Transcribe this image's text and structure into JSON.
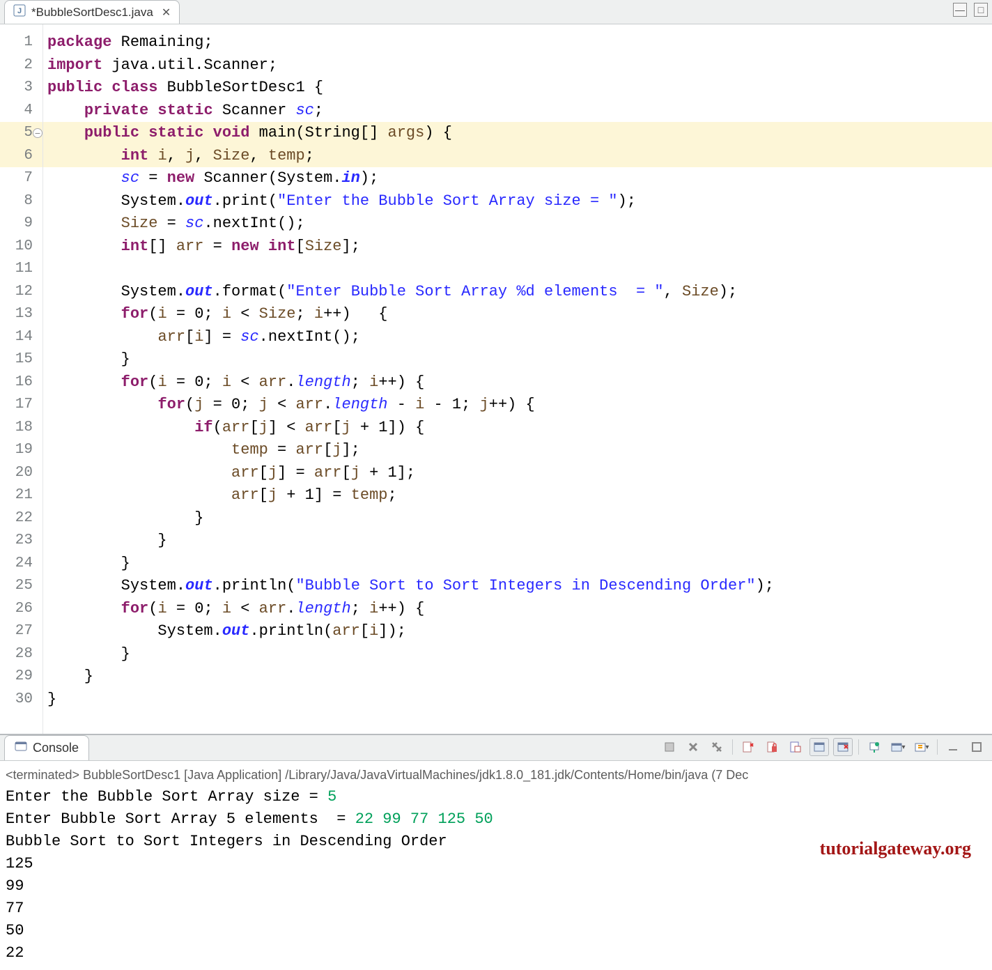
{
  "editor": {
    "tab": {
      "filename": "*BubbleSortDesc1.java"
    },
    "lines": [
      {
        "n": 1,
        "hl": false,
        "tokens": [
          [
            "kw",
            "package"
          ],
          [
            "pln",
            " Remaining;"
          ]
        ]
      },
      {
        "n": 2,
        "hl": false,
        "tokens": [
          [
            "kw",
            "import"
          ],
          [
            "pln",
            " java.util.Scanner;"
          ]
        ]
      },
      {
        "n": 3,
        "hl": false,
        "tokens": [
          [
            "kw",
            "public class"
          ],
          [
            "pln",
            " BubbleSortDesc1 {"
          ]
        ]
      },
      {
        "n": 4,
        "hl": false,
        "tokens": [
          [
            "pln",
            "    "
          ],
          [
            "kw",
            "private static"
          ],
          [
            "pln",
            " Scanner "
          ],
          [
            "sfld",
            "sc"
          ],
          [
            "pln",
            ";"
          ]
        ]
      },
      {
        "n": 5,
        "hl": true,
        "fold": true,
        "tokens": [
          [
            "pln",
            "    "
          ],
          [
            "kw",
            "public static void"
          ],
          [
            "pln",
            " main(String[] "
          ],
          [
            "parm",
            "args"
          ],
          [
            "pln",
            ") {"
          ]
        ]
      },
      {
        "n": 6,
        "hl": true,
        "tokens": [
          [
            "pln",
            "        "
          ],
          [
            "kw",
            "int"
          ],
          [
            "pln",
            " "
          ],
          [
            "var",
            "i"
          ],
          [
            "pln",
            ", "
          ],
          [
            "var",
            "j"
          ],
          [
            "pln",
            ", "
          ],
          [
            "var",
            "Size"
          ],
          [
            "pln",
            ", "
          ],
          [
            "var",
            "temp"
          ],
          [
            "pln",
            ";"
          ]
        ]
      },
      {
        "n": 7,
        "hl": false,
        "tokens": [
          [
            "pln",
            "        "
          ],
          [
            "sfld",
            "sc"
          ],
          [
            "pln",
            " = "
          ],
          [
            "kw",
            "new"
          ],
          [
            "pln",
            " Scanner(System."
          ],
          [
            "fld",
            "in"
          ],
          [
            "pln",
            ");"
          ]
        ]
      },
      {
        "n": 8,
        "hl": false,
        "tokens": [
          [
            "pln",
            "        System."
          ],
          [
            "fld",
            "out"
          ],
          [
            "pln",
            ".print("
          ],
          [
            "str",
            "\"Enter the Bubble Sort Array size = \""
          ],
          [
            "pln",
            ");"
          ]
        ]
      },
      {
        "n": 9,
        "hl": false,
        "tokens": [
          [
            "pln",
            "        "
          ],
          [
            "var",
            "Size"
          ],
          [
            "pln",
            " = "
          ],
          [
            "sfld",
            "sc"
          ],
          [
            "pln",
            ".nextInt();"
          ]
        ]
      },
      {
        "n": 10,
        "hl": false,
        "tokens": [
          [
            "pln",
            "        "
          ],
          [
            "kw",
            "int"
          ],
          [
            "pln",
            "[] "
          ],
          [
            "var",
            "arr"
          ],
          [
            "pln",
            " = "
          ],
          [
            "kw",
            "new int"
          ],
          [
            "pln",
            "["
          ],
          [
            "var",
            "Size"
          ],
          [
            "pln",
            "];"
          ]
        ]
      },
      {
        "n": 11,
        "hl": false,
        "tokens": [
          [
            "pln",
            ""
          ]
        ]
      },
      {
        "n": 12,
        "hl": false,
        "tokens": [
          [
            "pln",
            "        System."
          ],
          [
            "fld",
            "out"
          ],
          [
            "pln",
            ".format("
          ],
          [
            "str",
            "\"Enter Bubble Sort Array %d elements  = \""
          ],
          [
            "pln",
            ", "
          ],
          [
            "var",
            "Size"
          ],
          [
            "pln",
            ");"
          ]
        ]
      },
      {
        "n": 13,
        "hl": false,
        "tokens": [
          [
            "pln",
            "        "
          ],
          [
            "kw",
            "for"
          ],
          [
            "pln",
            "("
          ],
          [
            "var",
            "i"
          ],
          [
            "pln",
            " = 0; "
          ],
          [
            "var",
            "i"
          ],
          [
            "pln",
            " < "
          ],
          [
            "var",
            "Size"
          ],
          [
            "pln",
            "; "
          ],
          [
            "var",
            "i"
          ],
          [
            "pln",
            "++)   {"
          ]
        ]
      },
      {
        "n": 14,
        "hl": false,
        "tokens": [
          [
            "pln",
            "            "
          ],
          [
            "var",
            "arr"
          ],
          [
            "pln",
            "["
          ],
          [
            "var",
            "i"
          ],
          [
            "pln",
            "] = "
          ],
          [
            "sfld",
            "sc"
          ],
          [
            "pln",
            ".nextInt();"
          ]
        ]
      },
      {
        "n": 15,
        "hl": false,
        "tokens": [
          [
            "pln",
            "        }"
          ]
        ]
      },
      {
        "n": 16,
        "hl": false,
        "tokens": [
          [
            "pln",
            "        "
          ],
          [
            "kw",
            "for"
          ],
          [
            "pln",
            "("
          ],
          [
            "var",
            "i"
          ],
          [
            "pln",
            " = 0; "
          ],
          [
            "var",
            "i"
          ],
          [
            "pln",
            " < "
          ],
          [
            "var",
            "arr"
          ],
          [
            "pln",
            "."
          ],
          [
            "sfld",
            "length"
          ],
          [
            "pln",
            "; "
          ],
          [
            "var",
            "i"
          ],
          [
            "pln",
            "++) {"
          ]
        ]
      },
      {
        "n": 17,
        "hl": false,
        "tokens": [
          [
            "pln",
            "            "
          ],
          [
            "kw",
            "for"
          ],
          [
            "pln",
            "("
          ],
          [
            "var",
            "j"
          ],
          [
            "pln",
            " = 0; "
          ],
          [
            "var",
            "j"
          ],
          [
            "pln",
            " < "
          ],
          [
            "var",
            "arr"
          ],
          [
            "pln",
            "."
          ],
          [
            "sfld",
            "length"
          ],
          [
            "pln",
            " - "
          ],
          [
            "var",
            "i"
          ],
          [
            "pln",
            " - 1; "
          ],
          [
            "var",
            "j"
          ],
          [
            "pln",
            "++) {"
          ]
        ]
      },
      {
        "n": 18,
        "hl": false,
        "tokens": [
          [
            "pln",
            "                "
          ],
          [
            "kw",
            "if"
          ],
          [
            "pln",
            "("
          ],
          [
            "var",
            "arr"
          ],
          [
            "pln",
            "["
          ],
          [
            "var",
            "j"
          ],
          [
            "pln",
            "] < "
          ],
          [
            "var",
            "arr"
          ],
          [
            "pln",
            "["
          ],
          [
            "var",
            "j"
          ],
          [
            "pln",
            " + 1]) {"
          ]
        ]
      },
      {
        "n": 19,
        "hl": false,
        "tokens": [
          [
            "pln",
            "                    "
          ],
          [
            "var",
            "temp"
          ],
          [
            "pln",
            " = "
          ],
          [
            "var",
            "arr"
          ],
          [
            "pln",
            "["
          ],
          [
            "var",
            "j"
          ],
          [
            "pln",
            "];"
          ]
        ]
      },
      {
        "n": 20,
        "hl": false,
        "tokens": [
          [
            "pln",
            "                    "
          ],
          [
            "var",
            "arr"
          ],
          [
            "pln",
            "["
          ],
          [
            "var",
            "j"
          ],
          [
            "pln",
            "] = "
          ],
          [
            "var",
            "arr"
          ],
          [
            "pln",
            "["
          ],
          [
            "var",
            "j"
          ],
          [
            "pln",
            " + 1];"
          ]
        ]
      },
      {
        "n": 21,
        "hl": false,
        "tokens": [
          [
            "pln",
            "                    "
          ],
          [
            "var",
            "arr"
          ],
          [
            "pln",
            "["
          ],
          [
            "var",
            "j"
          ],
          [
            "pln",
            " + 1] = "
          ],
          [
            "var",
            "temp"
          ],
          [
            "pln",
            ";"
          ]
        ]
      },
      {
        "n": 22,
        "hl": false,
        "tokens": [
          [
            "pln",
            "                }"
          ]
        ]
      },
      {
        "n": 23,
        "hl": false,
        "tokens": [
          [
            "pln",
            "            }"
          ]
        ]
      },
      {
        "n": 24,
        "hl": false,
        "tokens": [
          [
            "pln",
            "        }"
          ]
        ]
      },
      {
        "n": 25,
        "hl": false,
        "tokens": [
          [
            "pln",
            "        System."
          ],
          [
            "fld",
            "out"
          ],
          [
            "pln",
            ".println("
          ],
          [
            "str",
            "\"Bubble Sort to Sort Integers in Descending Order\""
          ],
          [
            "pln",
            ");"
          ]
        ]
      },
      {
        "n": 26,
        "hl": false,
        "tokens": [
          [
            "pln",
            "        "
          ],
          [
            "kw",
            "for"
          ],
          [
            "pln",
            "("
          ],
          [
            "var",
            "i"
          ],
          [
            "pln",
            " = 0; "
          ],
          [
            "var",
            "i"
          ],
          [
            "pln",
            " < "
          ],
          [
            "var",
            "arr"
          ],
          [
            "pln",
            "."
          ],
          [
            "sfld",
            "length"
          ],
          [
            "pln",
            "; "
          ],
          [
            "var",
            "i"
          ],
          [
            "pln",
            "++) {"
          ]
        ]
      },
      {
        "n": 27,
        "hl": false,
        "tokens": [
          [
            "pln",
            "            System."
          ],
          [
            "fld",
            "out"
          ],
          [
            "pln",
            ".println("
          ],
          [
            "var",
            "arr"
          ],
          [
            "pln",
            "["
          ],
          [
            "var",
            "i"
          ],
          [
            "pln",
            "]);"
          ]
        ]
      },
      {
        "n": 28,
        "hl": false,
        "tokens": [
          [
            "pln",
            "        }"
          ]
        ]
      },
      {
        "n": 29,
        "hl": false,
        "tokens": [
          [
            "pln",
            "    }"
          ]
        ]
      },
      {
        "n": 30,
        "hl": false,
        "tokens": [
          [
            "pln",
            "}"
          ]
        ]
      }
    ]
  },
  "console": {
    "tab_label": "Console",
    "status": "<terminated> BubbleSortDesc1 [Java Application] /Library/Java/JavaVirtualMachines/jdk1.8.0_181.jdk/Contents/Home/bin/java  (7 Dec",
    "lines": [
      {
        "segs": [
          [
            "out",
            "Enter the Bubble Sort Array size = "
          ],
          [
            "in",
            "5"
          ]
        ]
      },
      {
        "segs": [
          [
            "out",
            "Enter Bubble Sort Array 5 elements  = "
          ],
          [
            "in",
            "22 99 77 125 50"
          ]
        ]
      },
      {
        "segs": [
          [
            "out",
            "Bubble Sort to Sort Integers in Descending Order"
          ]
        ]
      },
      {
        "segs": [
          [
            "out",
            "125"
          ]
        ]
      },
      {
        "segs": [
          [
            "out",
            "99"
          ]
        ]
      },
      {
        "segs": [
          [
            "out",
            "77"
          ]
        ]
      },
      {
        "segs": [
          [
            "out",
            "50"
          ]
        ]
      },
      {
        "segs": [
          [
            "out",
            "22"
          ]
        ]
      }
    ],
    "watermark": "tutorialgateway.org"
  }
}
